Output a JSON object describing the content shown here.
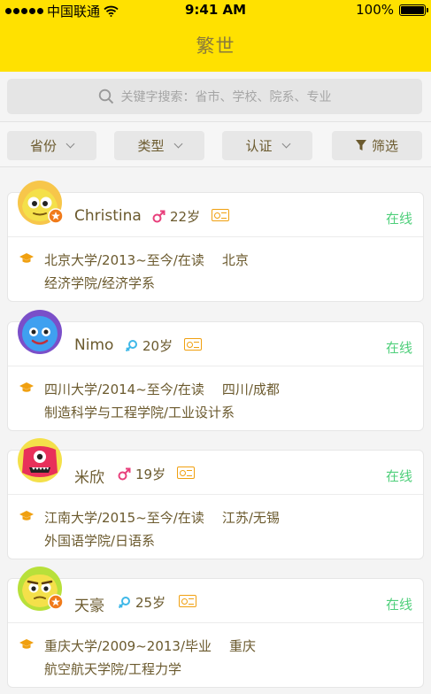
{
  "status_bar": {
    "carrier": "中国联通",
    "time": "9:41 AM",
    "battery": "100%",
    "battery_level": 1.0
  },
  "header": {
    "title": "繁世"
  },
  "search": {
    "placeholder": "关键字搜索：省市、学校、院系、专业"
  },
  "filters": {
    "province": "省份",
    "type": "类型",
    "verify": "认证",
    "filter": "筛选"
  },
  "colors": {
    "brand_yellow": "#ffe100",
    "online_green": "#4ecf7a",
    "accent_orange": "#f0a010",
    "male_pink": "#e8407c",
    "female_blue": "#3fb8e8"
  },
  "users": [
    {
      "name": "Christina",
      "gender": "male",
      "age": "22岁",
      "status": "在线",
      "school_info": "北京大学/2013~至今/在读",
      "city": "北京",
      "dept": "经济学院/经济学系",
      "verified_badge": true
    },
    {
      "name": "Nimo",
      "gender": "female",
      "age": "20岁",
      "status": "在线",
      "school_info": "四川大学/2014~至今/在读",
      "city": "四川/成都",
      "dept": "制造科学与工程学院/工业设计系",
      "verified_badge": false
    },
    {
      "name": "米欣",
      "gender": "male",
      "age": "19岁",
      "status": "在线",
      "school_info": "江南大学/2015~至今/在读",
      "city": "江苏/无锡",
      "dept": "外国语学院/日语系",
      "verified_badge": false
    },
    {
      "name": "天豪",
      "gender": "female",
      "age": "25岁",
      "status": "在线",
      "school_info": "重庆大学/2009~2013/毕业",
      "city": "重庆",
      "dept": "航空航天学院/工程力学",
      "verified_badge": true
    }
  ]
}
